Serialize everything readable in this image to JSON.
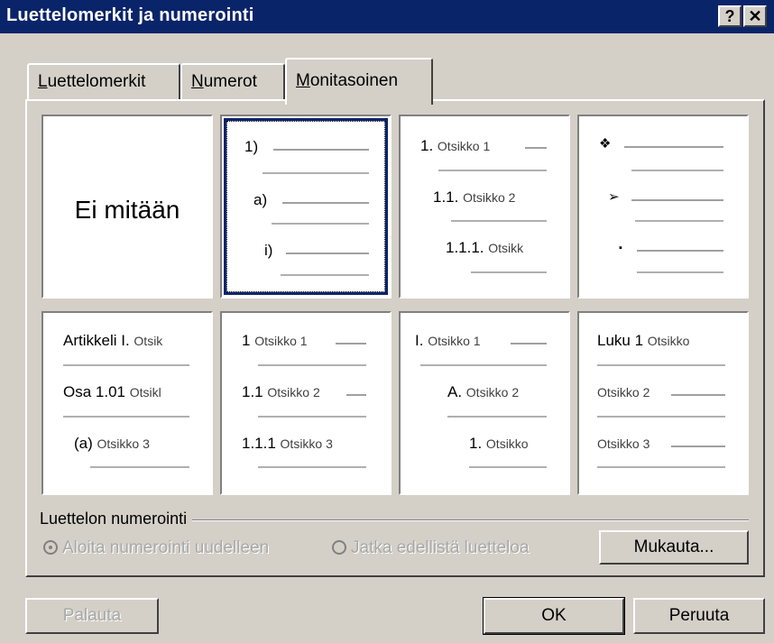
{
  "window": {
    "title": "Luettelomerkit ja numerointi",
    "help_label": "?",
    "close_label": "✕"
  },
  "tabs": [
    {
      "label": "Luettelomerkit",
      "mnemonic": "L",
      "rest": "uettelomerkit",
      "active": false
    },
    {
      "label": "Numerot",
      "mnemonic": "N",
      "rest": "umerot",
      "active": false
    },
    {
      "label": "Monitasoinen",
      "mnemonic": "M",
      "rest": "onitasoinen",
      "active": true
    }
  ],
  "gallery": {
    "none_label": "Ei mitään",
    "tile2": [
      "1)",
      "a)",
      "i)"
    ],
    "tile3": {
      "nums": [
        "1.",
        "1.1.",
        "1.1.1."
      ],
      "texts": [
        "Otsikko 1",
        "Otsikko 2",
        "Otsikk"
      ]
    },
    "tile4": [
      "❖",
      "➢",
      "▪"
    ],
    "tile5": {
      "nums": [
        "Artikkeli I.",
        "Osa 1.01",
        "(a)"
      ],
      "texts": [
        "Otsik",
        "Otsikl",
        "Otsikko 3"
      ]
    },
    "tile6": {
      "nums": [
        "1",
        "1.1",
        "1.1.1"
      ],
      "texts": [
        "Otsikko 1",
        "Otsikko 2",
        "Otsikko 3"
      ]
    },
    "tile7": {
      "nums": [
        "I.",
        "A.",
        "1."
      ],
      "texts": [
        "Otsikko 1",
        "Otsikko 2",
        "Otsikko"
      ]
    },
    "tile8": {
      "nums": [
        "Luku 1",
        "",
        ""
      ],
      "texts": [
        "Otsikko",
        "Otsikko 2",
        "Otsikko 3"
      ]
    }
  },
  "numbering": {
    "group_label": "Luettelon numerointi",
    "restart_label": "Aloita numerointi uudelleen",
    "continue_label": "Jatka edellistä luetteloa",
    "customize_label": "Mukauta...",
    "customize_mnemonic": "u"
  },
  "buttons": {
    "reset": "Palauta",
    "ok": "OK",
    "cancel": "Peruuta"
  }
}
